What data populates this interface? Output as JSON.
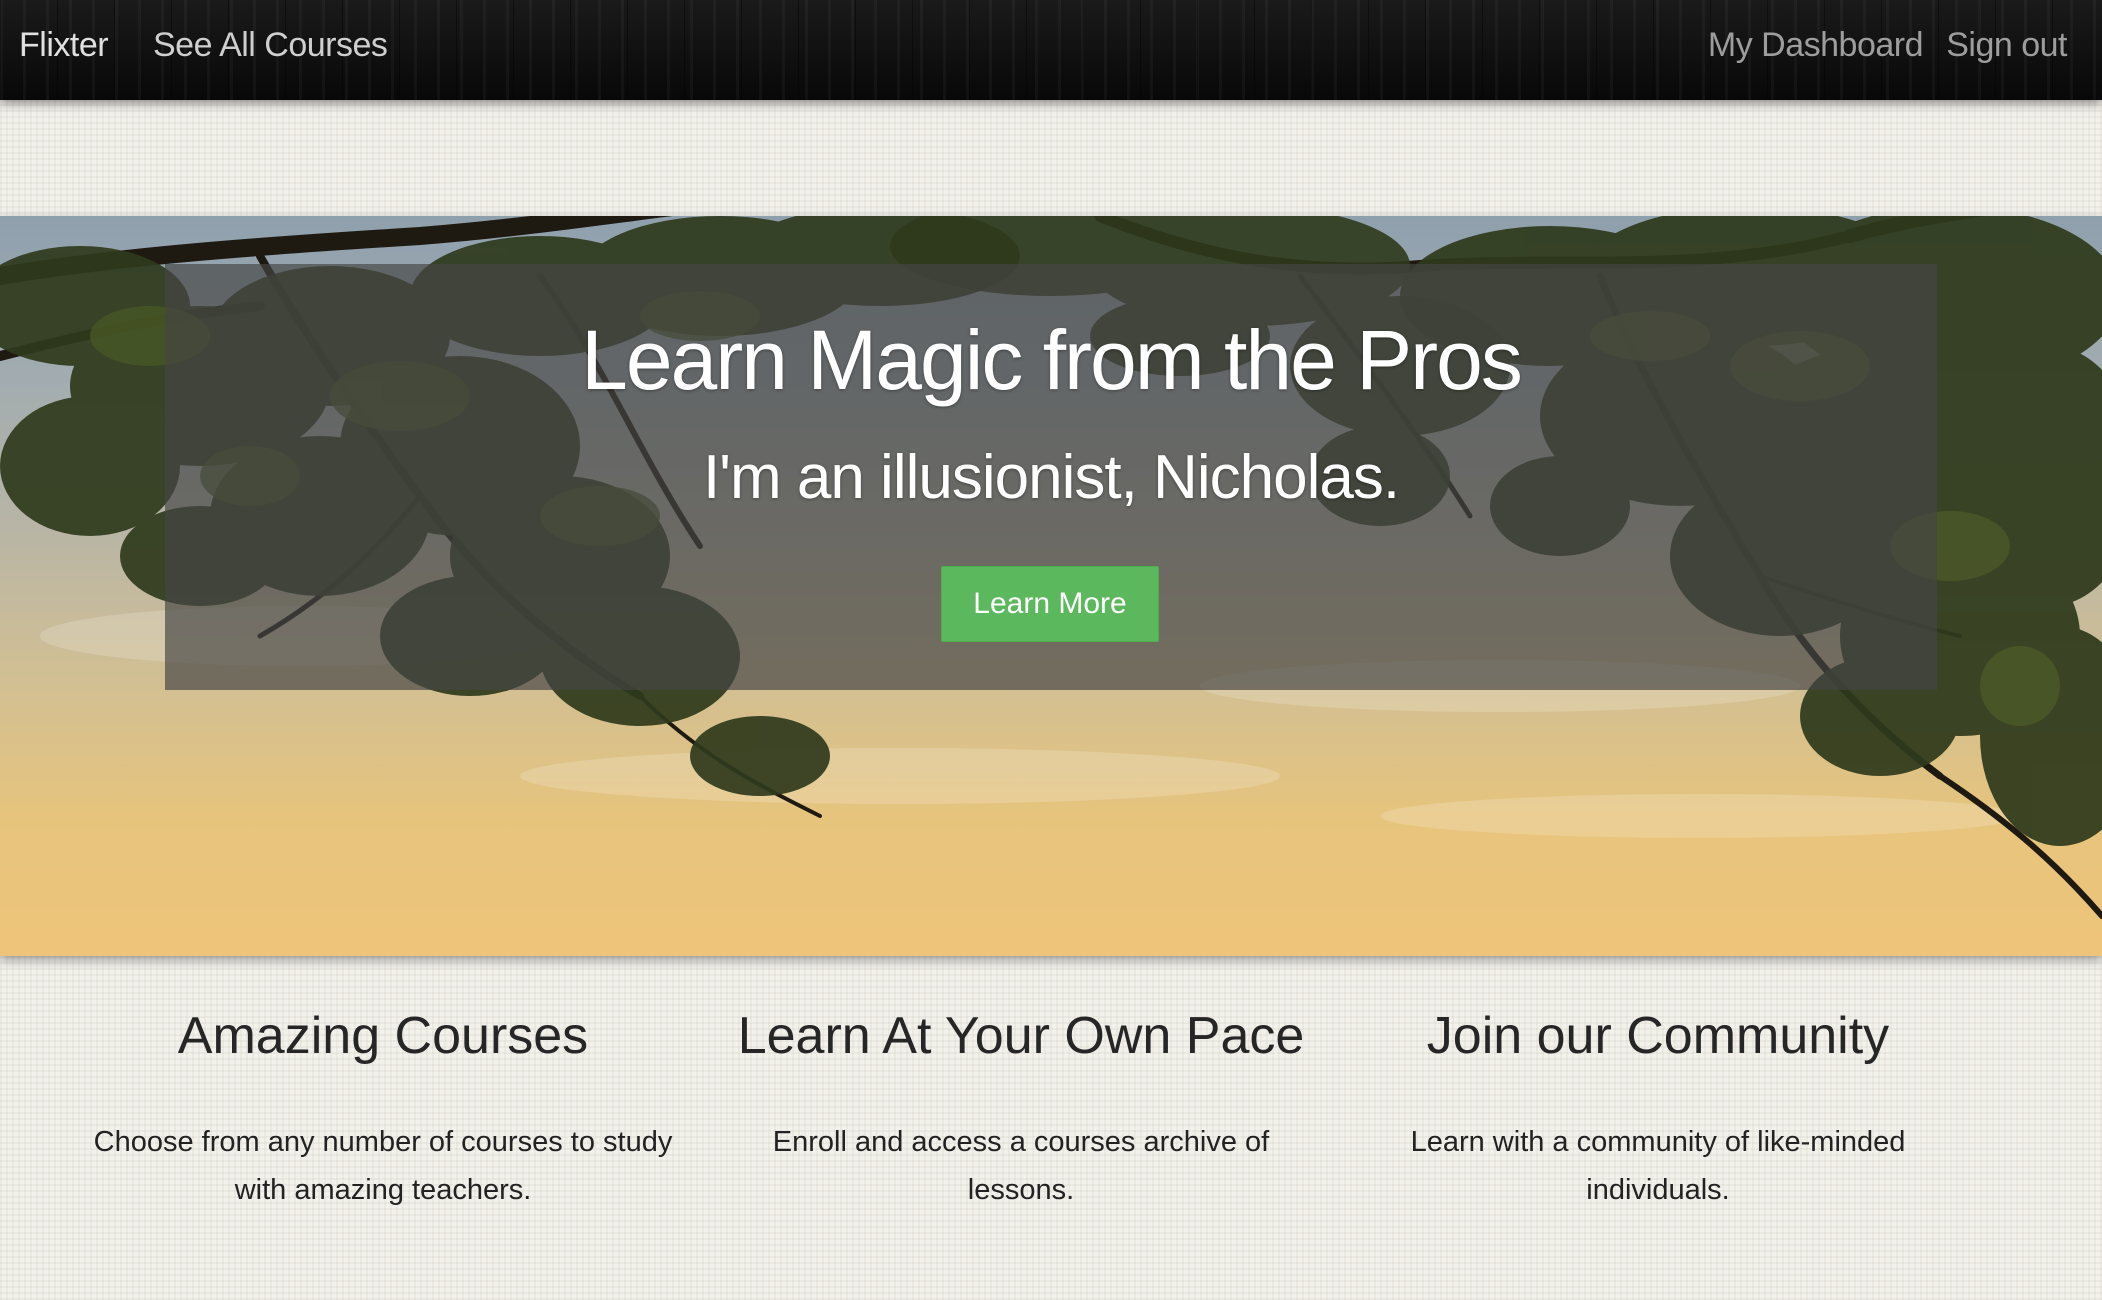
{
  "navbar": {
    "brand": "Flixter",
    "see_all_courses": "See All Courses",
    "my_dashboard": "My Dashboard",
    "sign_out": "Sign out"
  },
  "hero": {
    "title": "Learn Magic from the Pros",
    "subtitle": "I'm an illusionist, Nicholas.",
    "button_label": "Learn More"
  },
  "features": [
    {
      "heading": "Amazing Courses",
      "text": "Choose from any number of courses to study with amazing teachers."
    },
    {
      "heading": "Learn At Your Own Pace",
      "text": "Enroll and access a courses archive of lessons."
    },
    {
      "heading": "Join our Community",
      "text": "Learn with a community of like-minded individuals."
    }
  ],
  "colors": {
    "navbar_bg": "#0d0d0d",
    "button_green": "#5cb85c",
    "jumbotron_overlay": "rgba(70,70,70,0.68)"
  }
}
